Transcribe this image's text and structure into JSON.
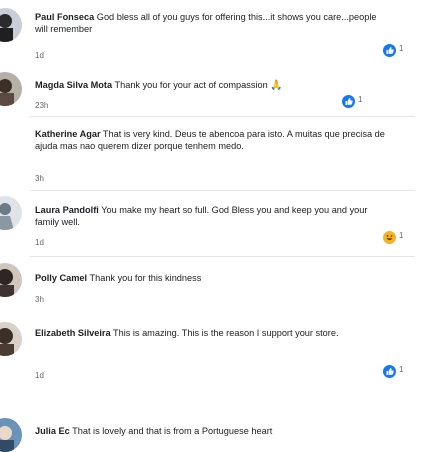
{
  "comments": [
    {
      "author": "Paul Fonseca",
      "text": "God bless all of you guys for offering this...it shows you care...people will remember",
      "time": "1d",
      "reaction": "like",
      "reaction_count": "1"
    },
    {
      "author": "Magda Silva Mota",
      "text": "Thank you for your act of compassion",
      "emoji": "🙏",
      "time": "23h",
      "reaction": "like",
      "reaction_count": "1"
    },
    {
      "author": "Katherine Agar",
      "text": "That is very kind. Deus te abencoa para isto. A muitas que precisa de ajuda mas nao querem dizer porque tenhem medo.",
      "time": "3h"
    },
    {
      "author": "Laura Pandolfi",
      "text": "You make my heart so full. God Bless you and keep you and your family well.",
      "time": "1d",
      "reaction": "haha",
      "reaction_count": "1"
    },
    {
      "author": "Polly Camel",
      "text": "Thank you for this kindness",
      "time": "3h"
    },
    {
      "author": "Elizabeth Silveira",
      "text": "This is amazing. This is the reason I support your store.",
      "time": "1d",
      "reaction": "like",
      "reaction_count": "1"
    },
    {
      "author": "Julia Ec",
      "text": "That is lovely and that is from a Portuguese heart"
    }
  ],
  "colors": {
    "like": "#1877f2",
    "haha": "#f7b125",
    "meta": "#65676b"
  }
}
